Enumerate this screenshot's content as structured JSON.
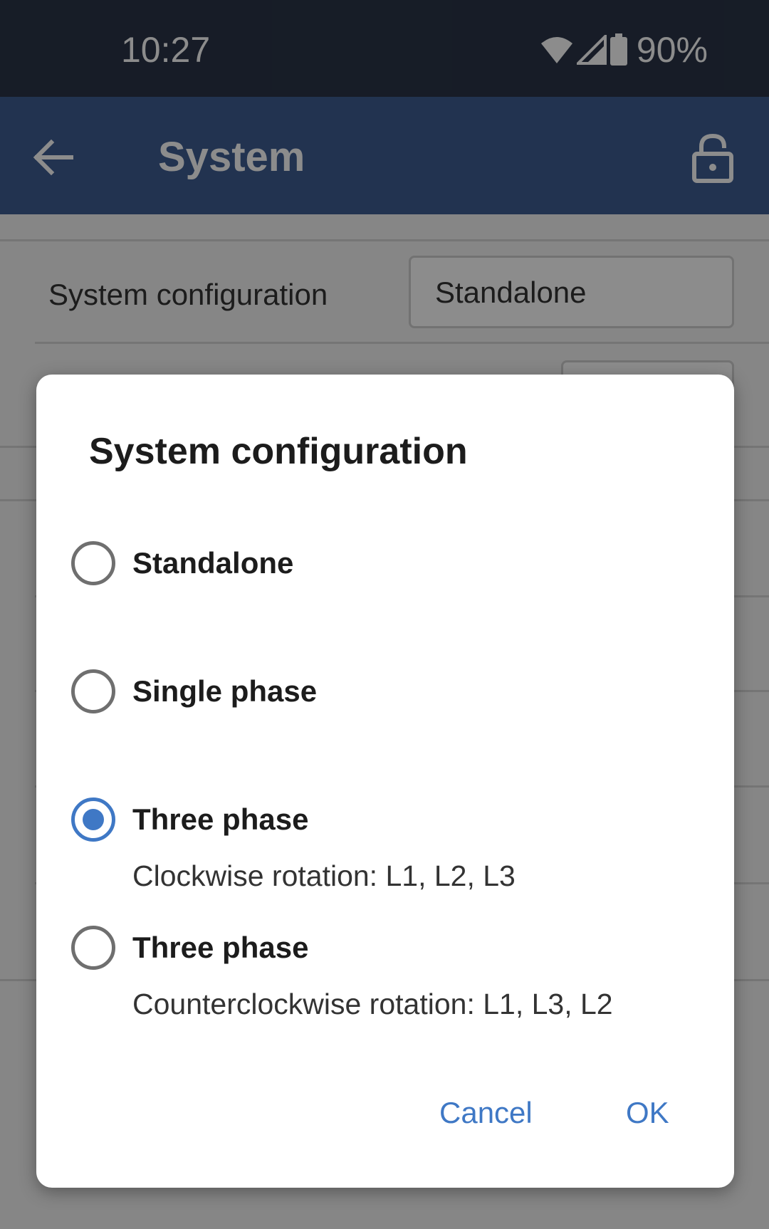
{
  "status_bar": {
    "time": "10:27",
    "battery": "90%",
    "icons": [
      "wifi-icon",
      "cell-signal-icon",
      "battery-icon"
    ]
  },
  "app_bar": {
    "title": "System",
    "back_icon": "back-arrow-icon",
    "lock_icon": "lock-icon",
    "background_color": "#3f5e93"
  },
  "background_content": {
    "rows": [
      {
        "label": "System configuration",
        "value": "Standalone"
      }
    ]
  },
  "dialog": {
    "title": "System configuration",
    "options": [
      {
        "label": "Standalone",
        "sublabel": "",
        "selected": false
      },
      {
        "label": "Single phase",
        "sublabel": "",
        "selected": false
      },
      {
        "label": "Three phase",
        "sublabel": "Clockwise rotation: L1, L2, L3",
        "selected": true
      },
      {
        "label": "Three phase",
        "sublabel": "Counterclockwise rotation: L1, L3, L2",
        "selected": false
      }
    ],
    "cancel_label": "Cancel",
    "ok_label": "OK",
    "accent_color": "#3f78c5"
  }
}
